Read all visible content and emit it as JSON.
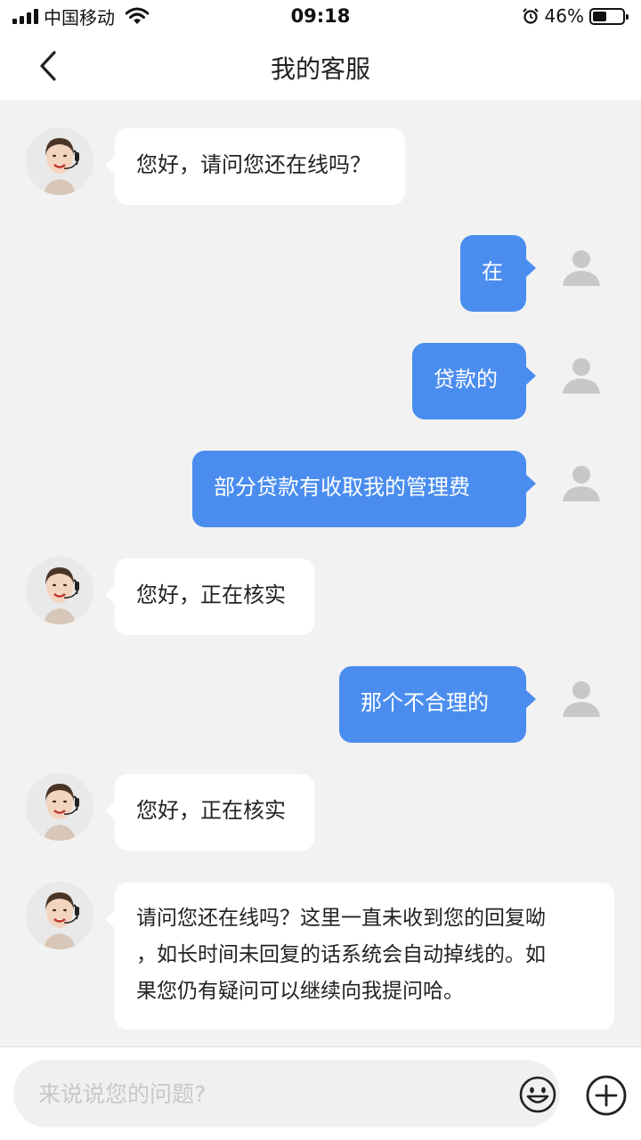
{
  "status_bar": {
    "carrier": "中国移动",
    "time": "09:18",
    "battery_percent": "46%",
    "battery_level": 0.46,
    "icons": [
      "signal-icon",
      "wifi-icon",
      "alarm-icon",
      "battery-icon"
    ]
  },
  "header": {
    "title": "我的客服",
    "back_icon": "chevron-left-icon"
  },
  "messages": [
    {
      "sender": "agent",
      "text": "您好，请问您还在线吗？"
    },
    {
      "sender": "user",
      "text": "在"
    },
    {
      "sender": "user",
      "text": "贷款的"
    },
    {
      "sender": "user",
      "text": "部分贷款有收取我的管理费"
    },
    {
      "sender": "agent",
      "text": "您好，正在核实"
    },
    {
      "sender": "user",
      "text": "那个不合理的"
    },
    {
      "sender": "agent",
      "text": "您好，正在核实"
    },
    {
      "sender": "agent",
      "lines": [
        "请问您还在线吗？这里一直未收到您的回复呦",
        "，如长时间未回复的话系统会自动掉线的。如",
        "果您仍有疑问可以继续向我提问哈。"
      ]
    }
  ],
  "input_bar": {
    "placeholder": "来说说您的问题?",
    "value": "",
    "emoji_icon": "smiley-icon",
    "plus_icon": "plus-circle-icon"
  },
  "colors": {
    "user_bubble": "#4a8def",
    "agent_bubble": "#ffffff",
    "chat_background": "#f2f2f2"
  }
}
